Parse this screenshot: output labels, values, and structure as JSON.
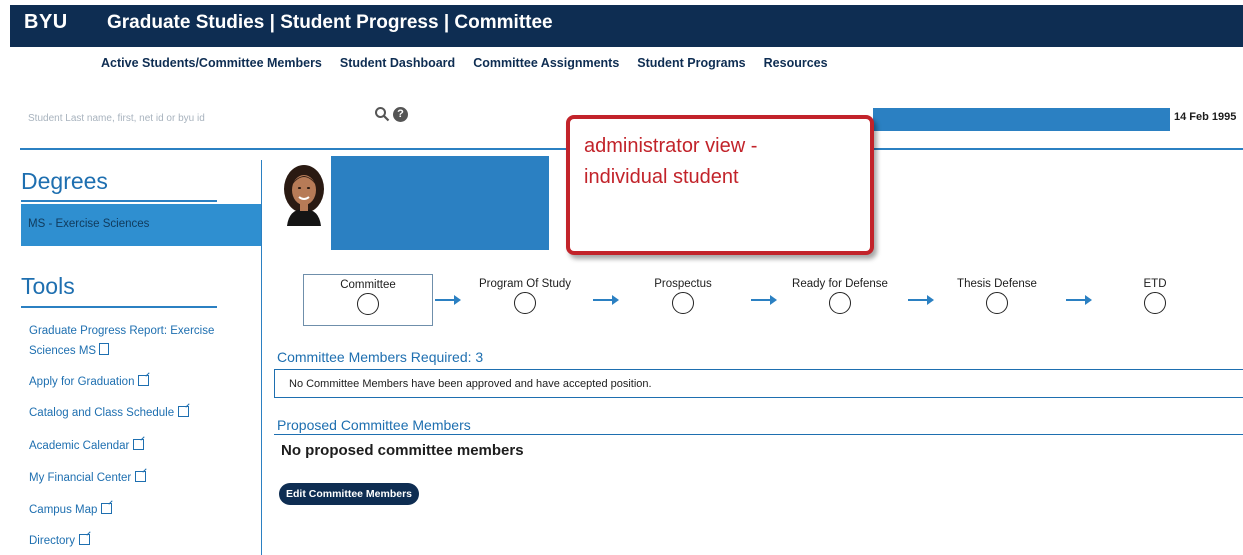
{
  "header": {
    "logo": "BYU",
    "title": "Graduate Studies | Student Progress | Committee"
  },
  "nav": {
    "items": [
      {
        "label": "Active Students/Committee Members"
      },
      {
        "label": "Student Dashboard"
      },
      {
        "label": "Committee Assignments"
      },
      {
        "label": "Student Programs"
      },
      {
        "label": "Resources"
      }
    ]
  },
  "search": {
    "placeholder": "Student Last name, first, net id or byu id",
    "icon": "search-icon",
    "help_icon": "question-icon",
    "help_glyph": "?"
  },
  "student": {
    "date": "14 Feb 1995",
    "photo_icon": "student-photo"
  },
  "callout": {
    "text": "administrator  view -\nindividual student",
    "color": "#c2232a"
  },
  "sidebar": {
    "degrees_heading": "Degrees",
    "degree": "MS - Exercise Sciences",
    "tools_heading": "Tools",
    "tools": [
      {
        "label": "Graduate Progress Report: Exercise Sciences MS",
        "icon": "pdf-icon"
      },
      {
        "label": "Apply for Graduation",
        "icon": "external-link-icon"
      },
      {
        "label": "Catalog and Class Schedule",
        "icon": "external-link-icon"
      },
      {
        "label": "Academic Calendar",
        "icon": "external-link-icon"
      },
      {
        "label": "My Financial Center",
        "icon": "external-link-icon"
      },
      {
        "label": "Campus Map",
        "icon": "external-link-icon"
      },
      {
        "label": "Directory",
        "icon": "external-link-icon"
      }
    ]
  },
  "progress": {
    "steps": [
      {
        "label": "Committee",
        "active": true
      },
      {
        "label": "Program Of Study"
      },
      {
        "label": "Prospectus"
      },
      {
        "label": "Ready for Defense"
      },
      {
        "label": "Thesis Defense"
      },
      {
        "label": "ETD"
      }
    ]
  },
  "committee": {
    "required_heading": "Committee Members Required: 3",
    "required_message": "No Committee Members have been approved and have accepted position.",
    "proposed_heading": "Proposed Committee Members",
    "proposed_empty": "No proposed committee members",
    "edit_button": "Edit Committee Members"
  },
  "colors": {
    "header_bg": "#0e2d52",
    "accent_blue": "#2b80c2",
    "link_blue": "#1e6fb0",
    "callout_red": "#c2232a"
  }
}
